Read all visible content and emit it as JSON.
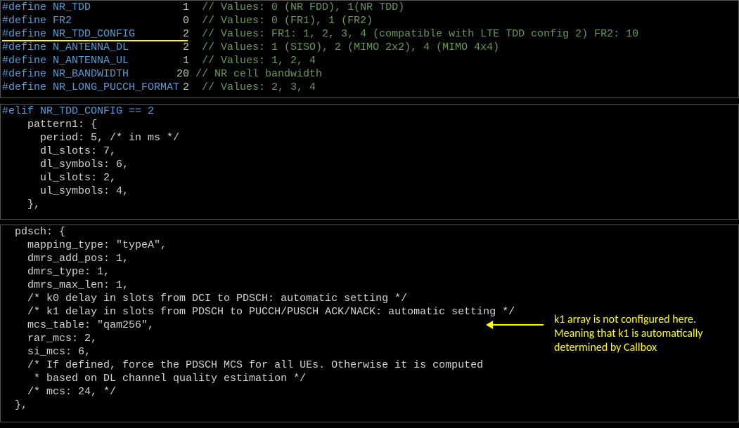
{
  "defs": [
    {
      "name": "NR_TDD",
      "val": "1",
      "comment": "// Values: 0 (NR FDD), 1(NR TDD)"
    },
    {
      "name": "FR2",
      "val": "0",
      "comment": "// Values: 0 (FR1), 1 (FR2)"
    },
    {
      "name": "NR_TDD_CONFIG",
      "val": "2",
      "comment": "// Values: FR1: 1, 2, 3, 4 (compatible with LTE TDD config 2) FR2: 10"
    },
    {
      "name": "N_ANTENNA_DL",
      "val": "2",
      "comment": "// Values: 1 (SISO), 2 (MIMO 2x2), 4 (MIMO 4x4)"
    },
    {
      "name": "N_ANTENNA_UL",
      "val": "1",
      "comment": "// Values: 1, 2, 4"
    },
    {
      "name": "NR_BANDWIDTH",
      "val": "20",
      "comment": "// NR cell bandwidth"
    },
    {
      "name": "NR_LONG_PUCCH_FORMAT",
      "val": "2",
      "comment": "// Values: 2, 3, 4"
    }
  ],
  "elif": {
    "cond": "#elif NR_TDD_CONFIG == 2",
    "lines": [
      "    pattern1: {",
      "      period: 5, /* in ms */",
      "      dl_slots: 7,",
      "      dl_symbols: 6,",
      "      ul_slots: 2,",
      "      ul_symbols: 4,",
      "    },"
    ]
  },
  "pdsch": {
    "lines": [
      "  pdsch: {",
      "    mapping_type: \"typeA\",",
      "    dmrs_add_pos: 1,",
      "    dmrs_type: 1,",
      "    dmrs_max_len: 1,",
      "    /* k0 delay in slots from DCI to PDSCH: automatic setting */",
      "    /* k1 delay in slots from PDSCH to PUCCH/PUSCH ACK/NACK: automatic setting */",
      "    mcs_table: \"qam256\",",
      "    rar_mcs: 2,",
      "    si_mcs: 6,",
      "    /* If defined, force the PDSCH MCS for all UEs. Otherwise it is computed",
      "     * based on DL channel quality estimation */",
      "    /* mcs: 24, */",
      "  },"
    ]
  },
  "annotation": "k1 array is not configured here. Meaning that k1 is automatically determined by Callbox"
}
